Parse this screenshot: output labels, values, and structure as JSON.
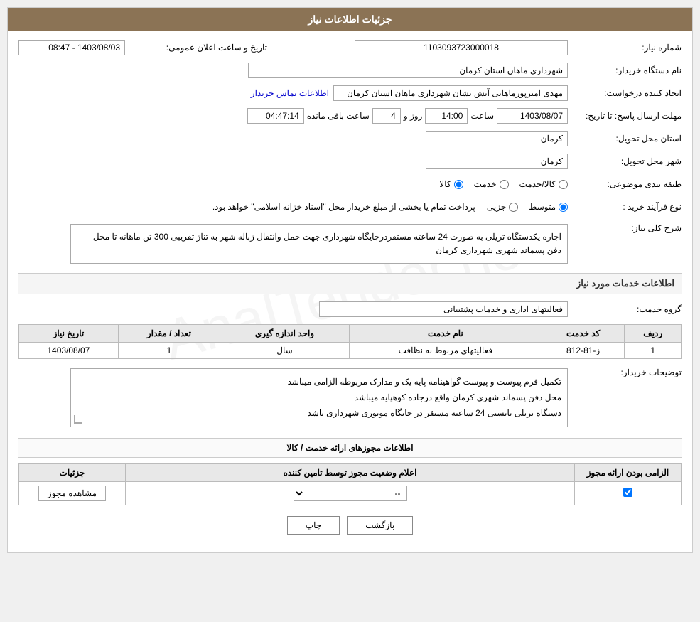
{
  "page": {
    "title": "جزئیات اطلاعات نیاز",
    "header_bg": "#8B7355"
  },
  "fields": {
    "need_number_label": "شماره نیاز:",
    "need_number_value": "1103093723000018",
    "buyer_name_label": "نام دستگاه خریدار:",
    "buyer_name_value": "شهرداری ماهان استان کرمان",
    "creator_label": "ایجاد کننده درخواست:",
    "creator_value": "مهدی امیرپورماهانی آتش نشان شهرداری ماهان استان کرمان",
    "contact_link": "اطلاعات تماس خریدار",
    "deadline_label": "مهلت ارسال پاسخ: تا تاریخ:",
    "deadline_date": "1403/08/07",
    "deadline_time_label": "ساعت",
    "deadline_time": "14:00",
    "deadline_days_label": "روز و",
    "deadline_days": "4",
    "countdown_label": "ساعت باقی مانده",
    "countdown_value": "04:47:14",
    "announce_label": "تاریخ و ساعت اعلان عمومی:",
    "announce_value": "1403/08/03 - 08:47",
    "province_label": "استان محل تحویل:",
    "province_value": "کرمان",
    "city_label": "شهر محل تحویل:",
    "city_value": "کرمان",
    "category_label": "طبقه بندی موضوعی:",
    "category_options": [
      "کالا",
      "خدمت",
      "کالا/خدمت"
    ],
    "category_selected": "کالا",
    "process_label": "نوع فرآیند خرید :",
    "process_options": [
      "جزیی",
      "متوسط"
    ],
    "process_selected": "متوسط",
    "process_note": "پرداخت تمام یا بخشی از مبلغ خریداز محل \"اسناد خزانه اسلامی\" خواهد بود.",
    "description_section_title": "شرح کلی نیاز:",
    "description_value": "اجاره یکدستگاه تریلی به صورت 24 ساعته مستقردرجایگاه شهرداری جهت حمل وانتقال زباله شهر به تناژ تقریبی 300 تن ماهانه تا محل دفن پسماند شهری شهرداری کرمان",
    "services_section_title": "اطلاعات خدمات مورد نیاز",
    "service_group_label": "گروه خدمت:",
    "service_group_value": "فعالیتهای اداری و خدمات پشتیبانی",
    "table_headers": {
      "row_num": "ردیف",
      "service_code": "کد خدمت",
      "service_name": "نام خدمت",
      "unit": "واحد اندازه گیری",
      "quantity": "تعداد / مقدار",
      "need_date": "تاریخ نیاز"
    },
    "table_rows": [
      {
        "row_num": "1",
        "service_code": "ز-81-812",
        "service_name": "فعالیتهای مربوط به نظافت",
        "unit": "سال",
        "quantity": "1",
        "need_date": "1403/08/07"
      }
    ],
    "buyer_notes_label": "توضیحات خریدار:",
    "buyer_notes_value": "تکمیل فرم پیوست و پیوست گواهینامه پایه یک و مدارک مربوطه الزامی میباشد\nمحل دفن پسماند شهری کرمان واقع درجاده کوهپایه میباشد\nدستگاه تریلی بایستی 24 ساعته مستقر در جایگاه موتوری شهرداری باشد",
    "permits_section_title": "اطلاعات مجوزهای ارائه خدمت / کالا",
    "permits_table_headers": {
      "mandatory": "الزامی بودن ارائه مجوز",
      "provider_status": "اعلام وضعیت مجوز توسط تامین کننده",
      "details": "جزئیات"
    },
    "permits_rows": [
      {
        "mandatory_checked": true,
        "provider_status_value": "--",
        "details_btn": "مشاهده مجوز"
      }
    ],
    "btn_print": "چاپ",
    "btn_back": "بازگشت"
  }
}
